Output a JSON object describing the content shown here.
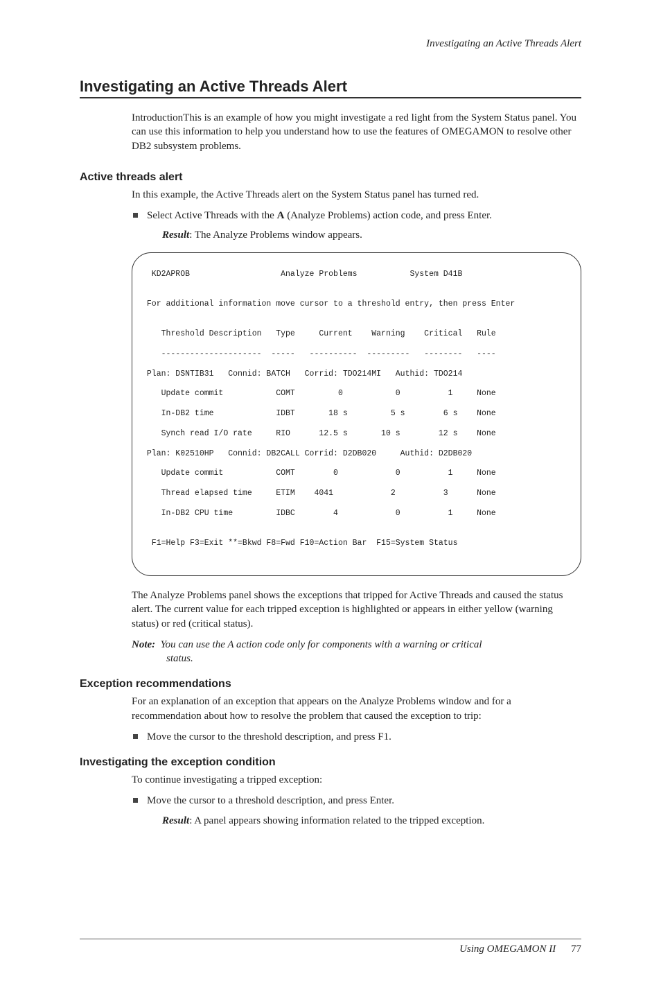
{
  "running_head": "Investigating an Active Threads Alert",
  "title": "Investigating an Active Threads Alert",
  "intro": "IntroductionThis is an example of how you might investigate a red light from the System Status panel. You can use this information to help you understand how to use the features of OMEGAMON to resolve other DB2 subsystem problems.",
  "s1": {
    "head": "Active threads alert",
    "p1": "In this example, the Active Threads alert on the System Status panel has turned red.",
    "b1_pre": "Select Active Threads with the ",
    "b1_bold": "A",
    "b1_post": " (Analyze Problems) action code, and press Enter.",
    "result_label": "Result",
    "result_text": ": The Analyze Problems window appears."
  },
  "terminal": {
    "l01": "  KD2APROB                   Analyze Problems           System D41B",
    "l02": "",
    "l03": " For additional information move cursor to a threshold entry, then press Enter",
    "l04": "",
    "l05": "    Threshold Description   Type     Current    Warning    Critical   Rule",
    "l06": "    ---------------------  -----   ----------  ---------   --------   ----",
    "l07": " Plan: DSNTIB31   Connid: BATCH   Corrid: TDO214MI   Authid: TDO214",
    "l08": "    Update commit           COMT         0           0          1     None",
    "l09": "    In-DB2 time             IDBT       18 s         5 s        6 s    None",
    "l10": "    Synch read I/O rate     RIO      12.5 s       10 s        12 s    None",
    "l11": " Plan: K02510HP   Connid: DB2CALL Corrid: D2DB020     Authid: D2DB020",
    "l12": "    Update commit           COMT        0            0          1     None",
    "l13": "    Thread elapsed time     ETIM    4041            2          3      None",
    "l14": "    In-DB2 CPU time         IDBC        4            0          1     None",
    "l15": "",
    "l16": "  F1=Help F3=Exit **=Bkwd F8=Fwd F10=Action Bar  F15=System Status"
  },
  "after_term": "The Analyze Problems panel shows the exceptions that tripped for Active Threads and caused the status alert. The current value for each tripped exception is highlighted or appears in either yellow (warning status) or red (critical status).",
  "note_label": "Note:",
  "note_line1": "You can use the A action code only for components with a warning or critical",
  "note_line2": "status.",
  "s2": {
    "head": "Exception recommendations",
    "p1": "For an explanation of an exception that appears on the Analyze Problems window and for a recommendation about how to resolve the problem that caused the exception to trip:",
    "b1": "Move the cursor to the threshold description, and press F1."
  },
  "s3": {
    "head": "Investigating the exception condition",
    "p1": "To continue investigating a tripped exception:",
    "b1": "Move the cursor to a threshold description, and press Enter.",
    "result_label": "Result",
    "result_text": ": A panel appears showing information related to the tripped exception."
  },
  "footer": {
    "book": "Using OMEGAMON II",
    "page": "77"
  }
}
